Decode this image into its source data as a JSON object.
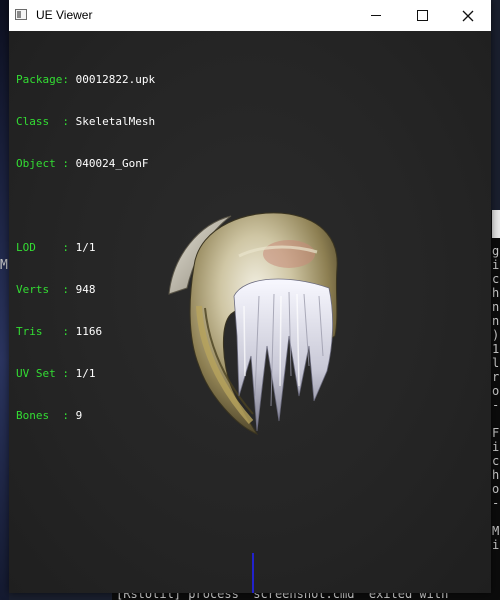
{
  "window": {
    "title": "UE Viewer",
    "controls": {
      "minimize": "minimize",
      "maximize": "maximize",
      "close": "close"
    }
  },
  "info": {
    "package": {
      "key": "Package:",
      "value": "00012822.upk"
    },
    "class": {
      "key": "Class  :",
      "value": "SkeletalMesh"
    },
    "object": {
      "key": "Object :",
      "value": "040024_GonF"
    },
    "lod": {
      "key": "LOD    :",
      "value": "1/1"
    },
    "verts": {
      "key": "Verts  :",
      "value": "948"
    },
    "tris": {
      "key": "Tris   :",
      "value": "1166"
    },
    "uvset": {
      "key": "UV Set :",
      "value": "1/1"
    },
    "bones": {
      "key": "Bones  :",
      "value": "9"
    }
  },
  "colors": {
    "label": "#33dd33",
    "value": "#ffffff",
    "viewport_bg": "#262626",
    "axis": "#2222cc"
  },
  "background": {
    "left_letter": "M",
    "terminal_column": [
      "g",
      "i",
      "c",
      "h",
      "n",
      "n",
      ")",
      "1",
      "l",
      "r",
      "o",
      "-",
      "",
      "F",
      "i",
      "c",
      "h",
      "o",
      "-",
      "",
      "M",
      "i"
    ],
    "status_line": "[RstUtil] process \"screenshot.cmd\" exited with"
  }
}
